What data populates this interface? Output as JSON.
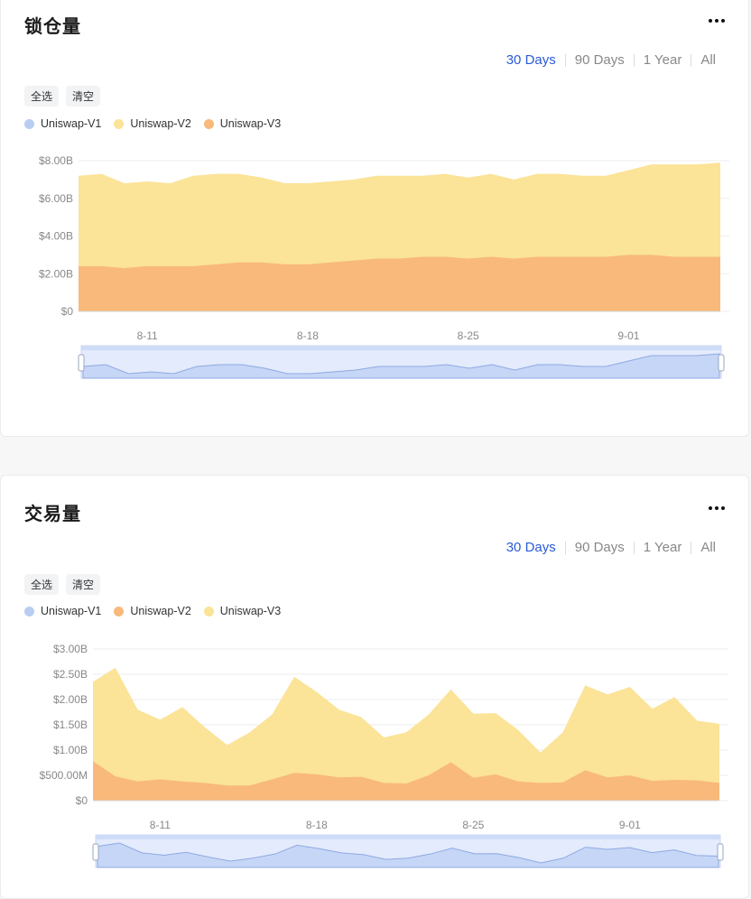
{
  "ranges": [
    "30 Days",
    "90 Days",
    "1 Year",
    "All"
  ],
  "active_range": "30 Days",
  "chips": {
    "select_all": "全选",
    "clear": "清空"
  },
  "colors": {
    "v1": "#b9cdf3",
    "v2_light": "#fbe398",
    "v3_orange": "#f8b97a",
    "navigator": "#dde7fb"
  },
  "tvl": {
    "title": "锁仓量",
    "legend": [
      {
        "name": "Uniswap-V1",
        "color": "#b9cdf3"
      },
      {
        "name": "Uniswap-V2",
        "color": "#fbe398"
      },
      {
        "name": "Uniswap-V3",
        "color": "#f8b97a"
      }
    ]
  },
  "volume": {
    "title": "交易量",
    "legend": [
      {
        "name": "Uniswap-V1",
        "color": "#b9cdf3"
      },
      {
        "name": "Uniswap-V2",
        "color": "#f8b97a"
      },
      {
        "name": "Uniswap-V3",
        "color": "#fbe398"
      }
    ]
  },
  "chart_data": [
    {
      "type": "area",
      "title": "锁仓量",
      "stacked": false,
      "x_ticks": [
        "8-11",
        "8-18",
        "8-25",
        "9-01"
      ],
      "x_tick_days": [
        3,
        10,
        17,
        24
      ],
      "y_ticks": [
        "$0",
        "$2.00B",
        "$4.00B",
        "$6.00B",
        "$8.00B"
      ],
      "y_tick_values": [
        0,
        2,
        4,
        6,
        8
      ],
      "ylim": [
        0,
        8
      ],
      "grid": true,
      "days": 29,
      "series": [
        {
          "name": "Uniswap-V2",
          "color": "#fbe398",
          "values": [
            7.2,
            7.3,
            6.8,
            6.9,
            6.8,
            7.2,
            7.3,
            7.3,
            7.1,
            6.8,
            6.8,
            6.9,
            7.0,
            7.2,
            7.2,
            7.2,
            7.3,
            7.1,
            7.3,
            7.0,
            7.3,
            7.3,
            7.2,
            7.2,
            7.5,
            7.8,
            7.8,
            7.8,
            7.9
          ]
        },
        {
          "name": "Uniswap-V3",
          "color": "#f8b97a",
          "values": [
            2.4,
            2.4,
            2.3,
            2.4,
            2.4,
            2.4,
            2.5,
            2.6,
            2.6,
            2.5,
            2.5,
            2.6,
            2.7,
            2.8,
            2.8,
            2.9,
            2.9,
            2.8,
            2.9,
            2.8,
            2.9,
            2.9,
            2.9,
            2.9,
            3.0,
            3.0,
            2.9,
            2.9,
            2.9
          ]
        }
      ]
    },
    {
      "type": "area",
      "title": "交易量",
      "stacked": false,
      "x_ticks": [
        "8-11",
        "8-18",
        "8-25",
        "9-01"
      ],
      "x_tick_days": [
        3,
        10,
        17,
        24
      ],
      "y_ticks": [
        "$0",
        "$500.00M",
        "$1.00B",
        "$1.50B",
        "$2.00B",
        "$2.50B",
        "$3.00B"
      ],
      "y_tick_values": [
        0,
        0.5,
        1,
        1.5,
        2,
        2.5,
        3
      ],
      "ylim": [
        0,
        3
      ],
      "grid": true,
      "days": 29,
      "series": [
        {
          "name": "Uniswap-V3",
          "color": "#fbe398",
          "values": [
            2.35,
            2.63,
            1.8,
            1.6,
            1.85,
            1.45,
            1.1,
            1.35,
            1.7,
            2.45,
            2.15,
            1.8,
            1.65,
            1.25,
            1.35,
            1.7,
            2.2,
            1.72,
            1.73,
            1.4,
            0.95,
            1.35,
            2.28,
            2.1,
            2.25,
            1.82,
            2.05,
            1.58,
            1.52
          ]
        },
        {
          "name": "Uniswap-V2",
          "color": "#f8b97a",
          "values": [
            0.78,
            0.48,
            0.38,
            0.42,
            0.38,
            0.35,
            0.3,
            0.3,
            0.42,
            0.55,
            0.52,
            0.46,
            0.47,
            0.35,
            0.34,
            0.5,
            0.76,
            0.45,
            0.52,
            0.38,
            0.35,
            0.36,
            0.6,
            0.46,
            0.5,
            0.39,
            0.41,
            0.4,
            0.35
          ]
        }
      ]
    }
  ]
}
